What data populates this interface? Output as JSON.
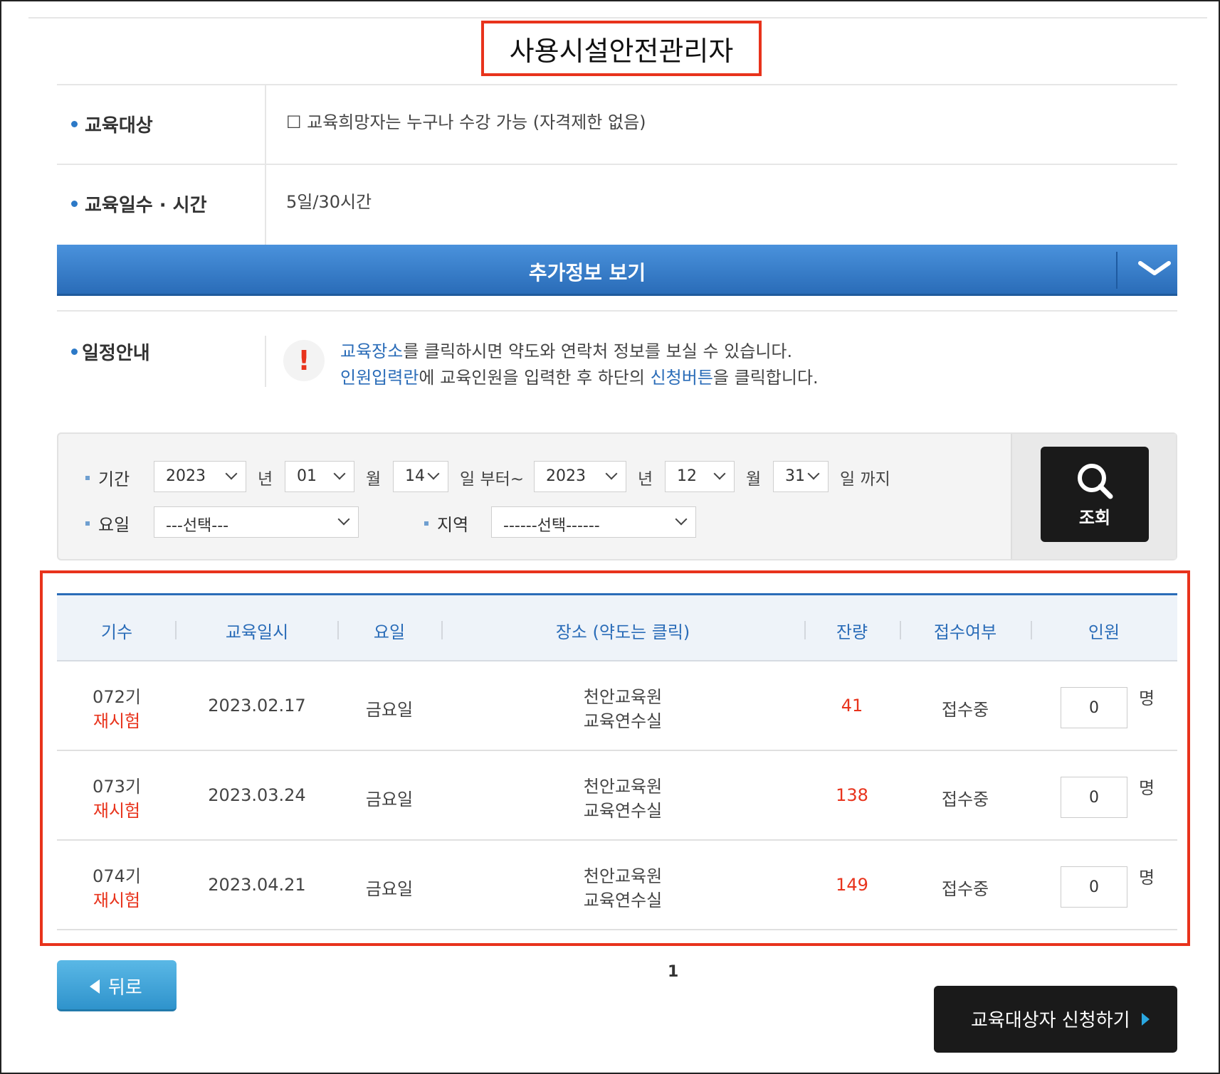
{
  "title": "사용시설안전관리자",
  "info": [
    {
      "label": "교육대상",
      "value": "☐ 교육희망자는 누구나 수강 가능 (자격제한 없음)"
    },
    {
      "label": "교육일수 · 시간",
      "value": "5일/30시간"
    }
  ],
  "more_info_label": "추가정보 보기",
  "schedule": {
    "label": "일정안내",
    "line1": {
      "link": "교육장소",
      "rest": "를 클릭하시면 약도와 연락처 정보를 보실 수 있습니다."
    },
    "line2": {
      "link1": "인원입력란",
      "mid": "에 교육인원을 입력한 후 하단의 ",
      "link2": "신청버튼",
      "end": "을 클릭합니다."
    }
  },
  "search": {
    "period_label": "기간",
    "weekday_label": "요일",
    "region_label": "지역",
    "from": {
      "year": "2023",
      "month": "01",
      "day": "14"
    },
    "to": {
      "year": "2023",
      "month": "12",
      "day": "31"
    },
    "units": {
      "year": "년",
      "month": "월",
      "from_day": "일 부터~",
      "to_day": "일 까지"
    },
    "weekday_value": "---선택---",
    "region_value": "------선택------",
    "button_label": "조회"
  },
  "table": {
    "headers": [
      "기수",
      "교육일시",
      "요일",
      "장소 (약도는 클릭)",
      "잔량",
      "접수여부",
      "인원"
    ],
    "rows": [
      {
        "term": "072기",
        "tag": "재시험",
        "date": "2023.02.17",
        "day": "금요일",
        "place": "천안교육원",
        "room": "교육연수실",
        "remaining": "41",
        "status": "접수중",
        "qty": "0",
        "unit": "명"
      },
      {
        "term": "073기",
        "tag": "재시험",
        "date": "2023.03.24",
        "day": "금요일",
        "place": "천안교육원",
        "room": "교육연수실",
        "remaining": "138",
        "status": "접수중",
        "qty": "0",
        "unit": "명"
      },
      {
        "term": "074기",
        "tag": "재시험",
        "date": "2023.04.21",
        "day": "금요일",
        "place": "천안교육원",
        "room": "교육연수실",
        "remaining": "149",
        "status": "접수중",
        "qty": "0",
        "unit": "명"
      }
    ]
  },
  "back_label": "뒤로",
  "page": "1",
  "apply_label": "교육대상자 신청하기",
  "colors": {
    "accent": "#2a6cb8",
    "highlight": "#e8331c"
  }
}
